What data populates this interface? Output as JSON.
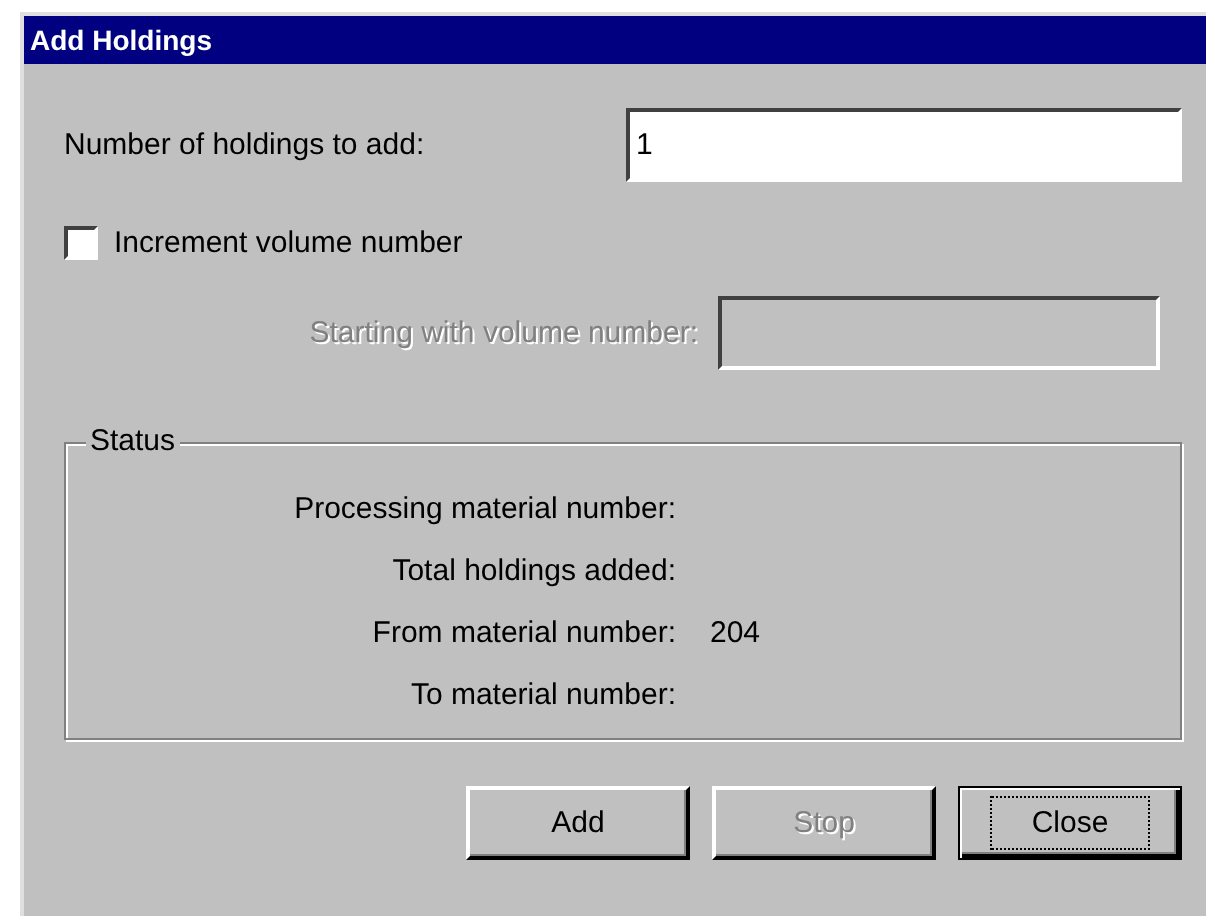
{
  "window": {
    "title": "Add Holdings"
  },
  "holdings_field": {
    "label": "Number of holdings to add:",
    "value": "1"
  },
  "increment_checkbox": {
    "label": "Increment volume number",
    "checked": false
  },
  "starting_volume_field": {
    "label": "Starting with volume number:",
    "disabled": true
  },
  "status": {
    "title": "Status",
    "rows": [
      {
        "label": "Processing material number:"
      },
      {
        "label": "Total holdings added:"
      },
      {
        "label": "From material number:",
        "value": "204"
      },
      {
        "label": "To material number:"
      }
    ]
  },
  "buttons": [
    {
      "label": "Add",
      "disabled": false,
      "focused": false
    },
    {
      "label": "Stop",
      "disabled": true,
      "focused": false
    },
    {
      "label": "Close",
      "disabled": false,
      "focused": true
    }
  ]
}
